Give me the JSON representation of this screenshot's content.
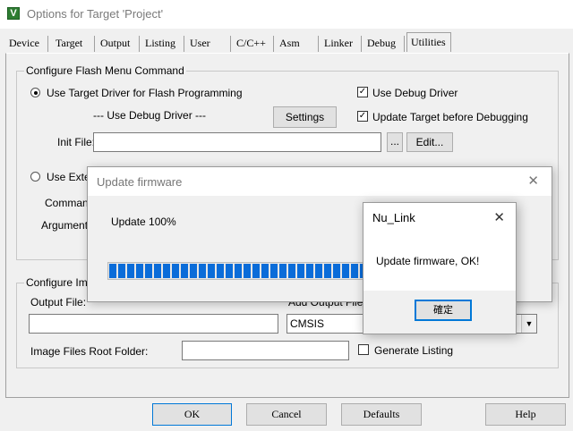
{
  "window": {
    "title": "Options for Target 'Project'",
    "icon": "keil-uvision-icon"
  },
  "tabs": [
    "Device",
    "Target",
    "Output",
    "Listing",
    "User",
    "C/C++",
    "Asm",
    "Linker",
    "Debug",
    "Utilities"
  ],
  "active_tab": "Utilities",
  "flash_group": {
    "legend": "Configure Flash Menu Command",
    "use_target_driver_label": "Use Target Driver for Flash Programming",
    "use_target_driver_selected": true,
    "debug_driver_text": "--- Use Debug Driver ---",
    "settings_label": "Settings",
    "use_debug_driver_label": "Use Debug Driver",
    "use_debug_driver_checked": true,
    "update_before_debug_label": "Update Target before Debugging",
    "update_before_debug_checked": true,
    "init_file_label": "Init File:",
    "init_file_value": "",
    "browse_label": "...",
    "edit_label": "Edit...",
    "use_external_label": "Use Exter",
    "use_external_selected": false,
    "command_label": "Command",
    "arguments_label": "Arguments"
  },
  "image_group": {
    "legend": "Configure Imag",
    "output_file_label": "Output File:",
    "output_file_value": "",
    "add_output_label": "Add Output File  t",
    "add_output_value": "CMSIS",
    "root_folder_label": "Image Files Root Folder:",
    "root_folder_value": "",
    "generate_listing_label": "Generate Listing",
    "generate_listing_checked": false
  },
  "update_dialog": {
    "title": "Update firmware",
    "message": "Update 100%",
    "progress_fraction": 1.0
  },
  "message_box": {
    "title": "Nu_Link",
    "text": "Update firmware, OK!",
    "ok_label": "確定"
  },
  "footer": {
    "ok": "OK",
    "cancel": "Cancel",
    "defaults": "Defaults",
    "help": "Help"
  },
  "glyphs": {
    "close": "✕",
    "check": "✓",
    "dropdown": "▼"
  }
}
